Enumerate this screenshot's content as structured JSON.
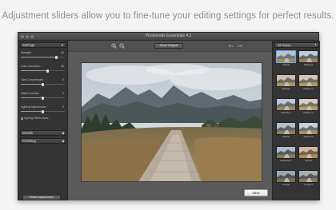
{
  "caption": "Adjustment sliders allow you to fine-tune your editing settings for perfect results.",
  "window": {
    "title": "Photomatix Essentials 4.2",
    "traffic_lights": [
      "close",
      "minimize",
      "zoom"
    ]
  },
  "left_panel": {
    "settings_header": "Settings",
    "sliders": [
      {
        "label": "Strength",
        "value": "80",
        "fraction": 0.8
      },
      {
        "label": "Color Saturation",
        "value": "60",
        "fraction": 0.6
      },
      {
        "label": "Tone Compression",
        "value": "0",
        "fraction": 0.5
      },
      {
        "label": "Detail Contrast",
        "value": "0",
        "fraction": 0.5
      },
      {
        "label": "Lighting Adjustments",
        "value": "0",
        "fraction": 0.5
      }
    ],
    "checkbox_label": "Lighting Effects Mode",
    "sections": [
      {
        "label": "Details"
      },
      {
        "label": "Finishing"
      }
    ],
    "reset_button": "Reset Adjustments"
  },
  "toolbar": {
    "zoom_in_icon": "zoom-in-icon",
    "zoom_out_icon": "zoom-out-icon",
    "show_original": "Show Original",
    "undo_icon": "undo-icon",
    "redo_icon": "redo-icon"
  },
  "save_button": "Save",
  "right_panel": {
    "dropdown_value": "All Styles",
    "thumbnails": [
      {
        "label": "Default"
      },
      {
        "label": "Balanced"
      },
      {
        "label": "Painterly"
      },
      {
        "label": "Painterly 2"
      },
      {
        "label": "Painterly 3"
      },
      {
        "label": "Painterly 4"
      },
      {
        "label": "Natural"
      },
      {
        "label": "Enhanced"
      },
      {
        "label": "Enhanced 2"
      },
      {
        "label": "Surreal"
      },
      {
        "label": "Grunge"
      },
      {
        "label": "Grunge 2"
      }
    ]
  },
  "colors": {
    "window_bg": "#3d3d3d",
    "panel_bg": "#343434",
    "main_bg": "#5a5a5a",
    "caption": "#8f8f8f",
    "selected_thumb": "#6fa5e8"
  }
}
